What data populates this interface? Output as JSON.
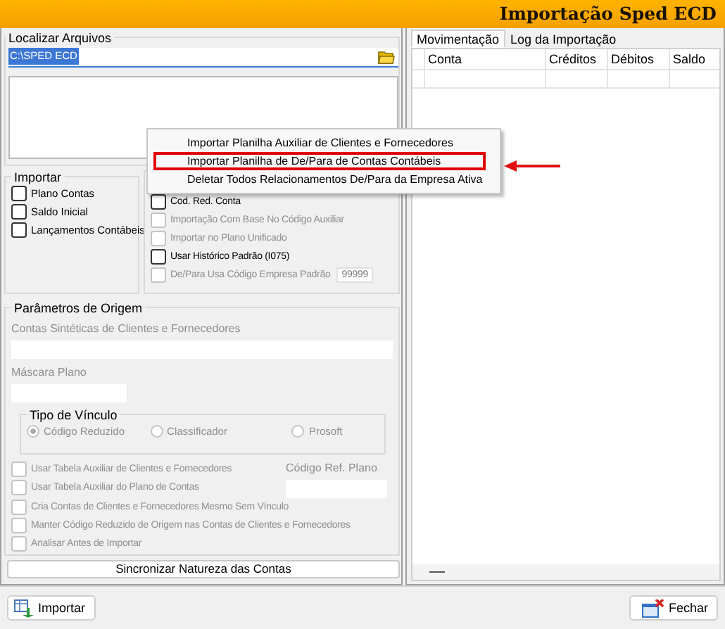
{
  "window": {
    "title": "Importação Sped ECD"
  },
  "file_group": {
    "title": "Localizar Arquivos",
    "path": "C:\\SPED ECD"
  },
  "import_group": {
    "title": "Importar",
    "options": [
      {
        "label": "Plano Contas",
        "checked": false
      },
      {
        "label": "Saldo Inicial",
        "checked": false
      },
      {
        "label": "Lançamentos Contábeis",
        "checked": false
      }
    ]
  },
  "options_group": {
    "options": [
      {
        "label": "Cod. Red. Conta",
        "checked": false,
        "disabled": false
      },
      {
        "label": "Importação Com Base No Código Auxiliar",
        "checked": false,
        "disabled": true
      },
      {
        "label": "Importar no Plano Unificado",
        "checked": false,
        "disabled": true
      },
      {
        "label": "Usar Histórico Padrão (I075)",
        "checked": false,
        "disabled": false
      },
      {
        "label": "De/Para Usa Código Empresa Padrão",
        "checked": false,
        "disabled": true,
        "value": "99999"
      }
    ]
  },
  "params": {
    "title": "Parâmetros de Origem",
    "fields": [
      {
        "label": "Contas Sintéticas de Clientes e Fornecedores",
        "disabled": true,
        "kind": "wide"
      },
      {
        "label": "Máscara Plano",
        "disabled": true,
        "kind": "short"
      }
    ],
    "link_type": {
      "title": "Tipo de Vínculo",
      "options": [
        {
          "label": "Código Reduzido",
          "selected": true,
          "disabled": true
        },
        {
          "label": "Classificador",
          "selected": false,
          "disabled": true
        },
        {
          "label": "Prosoft",
          "selected": false,
          "disabled": true
        }
      ]
    },
    "ref_field": {
      "label": "Código Ref. Plano",
      "disabled": true
    },
    "checks": [
      {
        "label": "Usar Tabela Auxiliar de Clientes e Fornecedores",
        "checked": false,
        "disabled": true
      },
      {
        "label": "Usar Tabela Auxiliar do Plano de Contas",
        "checked": false,
        "disabled": true
      },
      {
        "label": "Cria Contas de Clientes e Fornecedores Mesmo Sem Vínculo",
        "checked": false,
        "disabled": true
      },
      {
        "label": "Manter Código Reduzido de Origem nas Contas de Clientes e Fornecedores",
        "checked": false,
        "disabled": true
      },
      {
        "label": "Analisar Antes de Importar",
        "checked": false,
        "disabled": true
      }
    ]
  },
  "sync_button": {
    "label": "Sincronizar Natureza das Contas"
  },
  "tabs": [
    {
      "label": "Movimentação",
      "selected": true
    },
    {
      "label": "Log da Importação",
      "selected": false
    }
  ],
  "grid": {
    "columns": [
      "Conta",
      "Créditos",
      "Débitos",
      "Saldo"
    ]
  },
  "context_menu": [
    {
      "label": "Importar Planilha Auxiliar de Clientes e Fornecedores",
      "marked": false
    },
    {
      "label": "Importar Planilha de De/Para de Contas Contábeis",
      "marked": true
    },
    {
      "label": "Deletar Todos Relacionamentos De/Para da Empresa Ativa",
      "marked": false
    }
  ],
  "buttons": [
    {
      "label": "Importar",
      "kind": "import"
    },
    {
      "label": "Fechar",
      "kind": "close"
    }
  ]
}
